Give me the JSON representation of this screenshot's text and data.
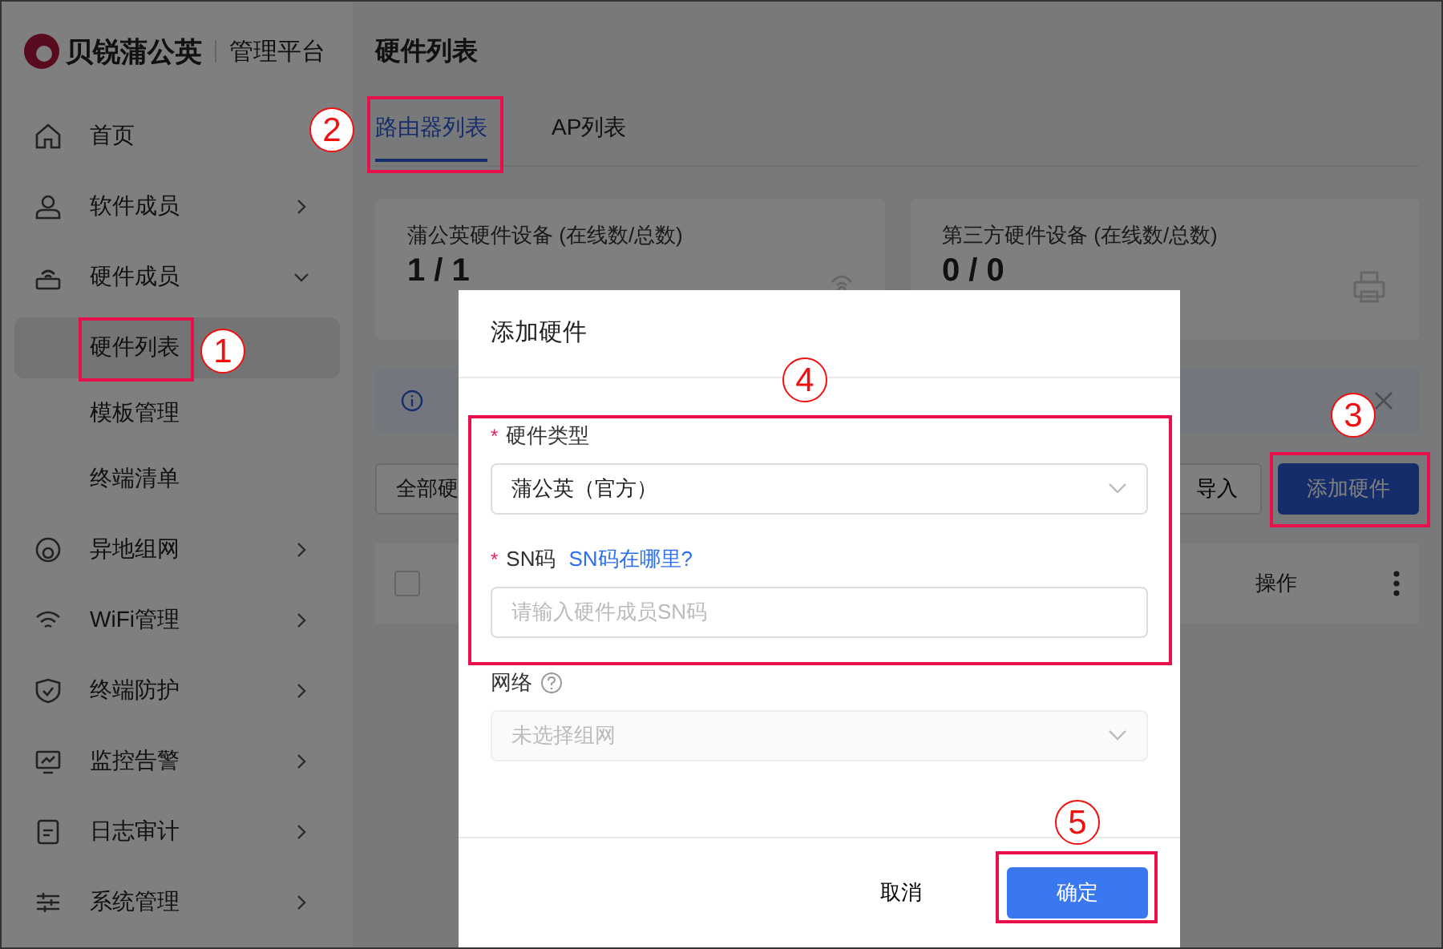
{
  "logo": {
    "brand": "贝锐蒲公英",
    "product": "管理平台"
  },
  "sidebar": {
    "items": [
      {
        "label": "首页",
        "kind": "link"
      },
      {
        "label": "软件成员",
        "kind": "group",
        "expanded": false
      },
      {
        "label": "硬件成员",
        "kind": "group",
        "expanded": true,
        "children": [
          {
            "label": "硬件列表",
            "selected": true
          },
          {
            "label": "模板管理",
            "selected": false
          },
          {
            "label": "终端清单",
            "selected": false
          }
        ]
      },
      {
        "label": "异地组网",
        "kind": "group",
        "expanded": false
      },
      {
        "label": "WiFi管理",
        "kind": "group",
        "expanded": false
      },
      {
        "label": "终端防护",
        "kind": "group",
        "expanded": false
      },
      {
        "label": "监控告警",
        "kind": "group",
        "expanded": false
      },
      {
        "label": "日志审计",
        "kind": "group",
        "expanded": false
      },
      {
        "label": "系统管理",
        "kind": "group",
        "expanded": false
      }
    ]
  },
  "page_title": "硬件列表",
  "tabs": [
    {
      "label": "路由器列表",
      "selected": true
    },
    {
      "label": "AP列表",
      "selected": false
    }
  ],
  "stat_cards": [
    {
      "title": "蒲公英硬件设备 (在线数/总数)",
      "value": "1 / 1"
    },
    {
      "title": "第三方硬件设备 (在线数/总数)",
      "value": "0 / 0"
    }
  ],
  "toolbar": {
    "filter": "全部硬",
    "import_button": "导入",
    "add_button": "添加硬件"
  },
  "table": {
    "header_checkbox": {
      "checked": false
    },
    "columns": [
      "操作"
    ]
  },
  "dialog": {
    "title": "添加硬件",
    "fields": [
      {
        "label": "硬件类型",
        "required_mark": "*",
        "kind": "select",
        "value": "蒲公英（官方）"
      },
      {
        "label": "SN码",
        "required_mark": "*",
        "kind": "input",
        "help_link": "SN码在哪里?",
        "placeholder": "请输入硬件成员SN码"
      },
      {
        "label": "网络",
        "kind": "select",
        "help_icon": true,
        "placeholder": "未选择组网",
        "disabled": true
      }
    ],
    "buttons": [
      {
        "label": "取消",
        "primary": false
      },
      {
        "label": "确定",
        "primary": true
      }
    ]
  },
  "annotations": [
    {
      "number": "1"
    },
    {
      "number": "2"
    },
    {
      "number": "3"
    },
    {
      "number": "4"
    },
    {
      "number": "5"
    }
  ]
}
